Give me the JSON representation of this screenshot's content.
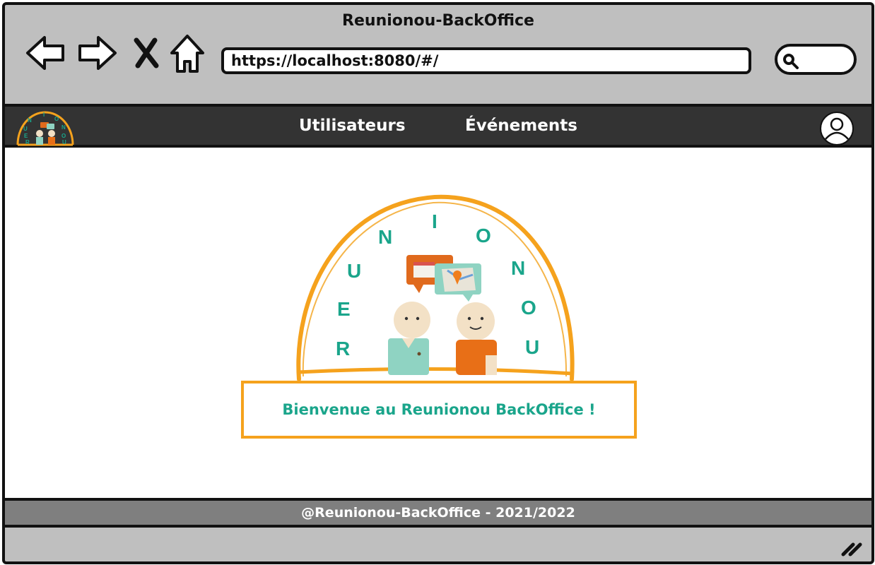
{
  "browser": {
    "title": "Reunionou-BackOffice",
    "url": "https://localhost:8080/#/"
  },
  "navbar": {
    "links": [
      {
        "label": "Utilisateurs"
      },
      {
        "label": "Événements"
      }
    ]
  },
  "logo": {
    "letters": [
      "U",
      "E",
      "R",
      "N",
      "I",
      "O",
      "N",
      "O",
      "U"
    ],
    "small_letters": [
      "N",
      "I",
      "O",
      "U",
      "N",
      "E",
      "O",
      "R",
      "U"
    ]
  },
  "main": {
    "welcome_text": "Bienvenue au Reunionou BackOffice !"
  },
  "footer": {
    "text": "@Reunionou-BackOffice - 2021/2022"
  },
  "colors": {
    "accent": "#f5a21d",
    "brand_teal": "#1aa58b",
    "navbar": "#333333",
    "footer": "#7f7f7f",
    "chrome": "#bfbfbf"
  }
}
